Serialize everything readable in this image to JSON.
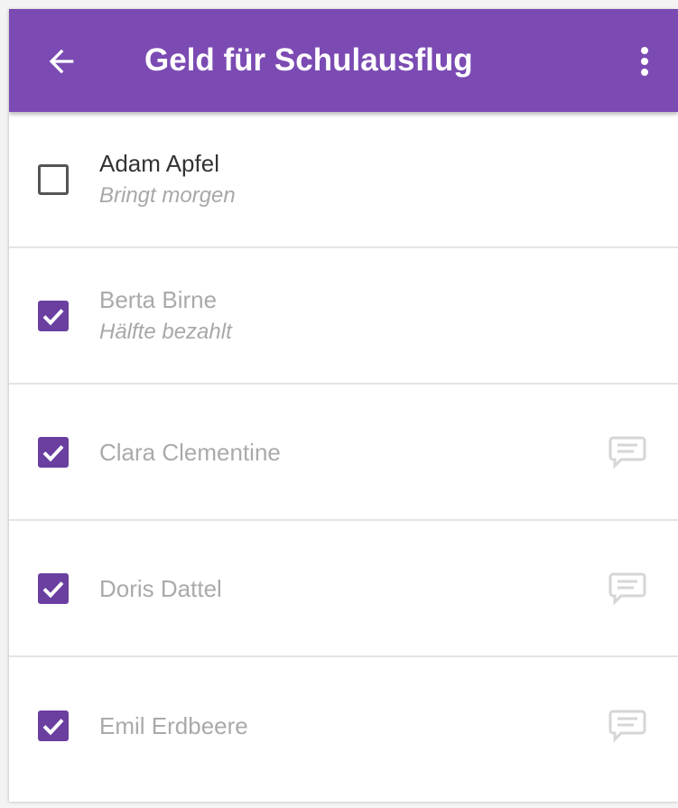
{
  "appbar": {
    "title": "Geld für Schulausflug",
    "back_icon": "arrow-left-icon",
    "menu_icon": "more-vertical-icon",
    "color": "#7b4bb3"
  },
  "colors": {
    "checkbox_checked": "#6a3fa0",
    "checkbox_unchecked_border": "#555555",
    "divider": "#e4e4e4"
  },
  "list": {
    "items": [
      {
        "name": "Adam Apfel",
        "note": "Bringt morgen",
        "checked": false,
        "has_comment_icon": false
      },
      {
        "name": "Berta Birne",
        "note": "Hälfte bezahlt",
        "checked": true,
        "has_comment_icon": false
      },
      {
        "name": "Clara Clementine",
        "note": "",
        "checked": true,
        "has_comment_icon": true
      },
      {
        "name": "Doris Dattel",
        "note": "",
        "checked": true,
        "has_comment_icon": true
      },
      {
        "name": "Emil Erdbeere",
        "note": "",
        "checked": true,
        "has_comment_icon": true
      }
    ]
  }
}
